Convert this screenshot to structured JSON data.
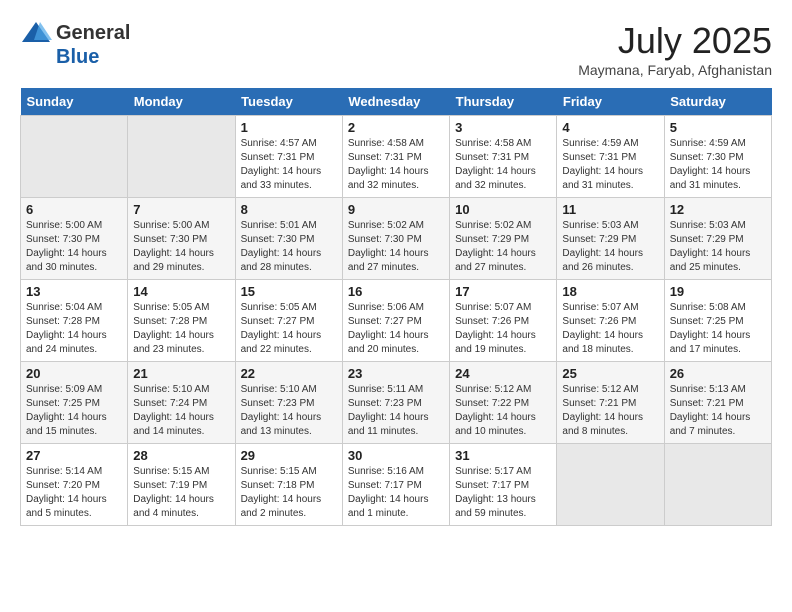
{
  "logo": {
    "general": "General",
    "blue": "Blue"
  },
  "header": {
    "month_year": "July 2025",
    "location": "Maymana, Faryab, Afghanistan"
  },
  "weekdays": [
    "Sunday",
    "Monday",
    "Tuesday",
    "Wednesday",
    "Thursday",
    "Friday",
    "Saturday"
  ],
  "weeks": [
    [
      {
        "day": "",
        "sunrise": "",
        "sunset": "",
        "daylight": ""
      },
      {
        "day": "",
        "sunrise": "",
        "sunset": "",
        "daylight": ""
      },
      {
        "day": "1",
        "sunrise": "Sunrise: 4:57 AM",
        "sunset": "Sunset: 7:31 PM",
        "daylight": "Daylight: 14 hours and 33 minutes."
      },
      {
        "day": "2",
        "sunrise": "Sunrise: 4:58 AM",
        "sunset": "Sunset: 7:31 PM",
        "daylight": "Daylight: 14 hours and 32 minutes."
      },
      {
        "day": "3",
        "sunrise": "Sunrise: 4:58 AM",
        "sunset": "Sunset: 7:31 PM",
        "daylight": "Daylight: 14 hours and 32 minutes."
      },
      {
        "day": "4",
        "sunrise": "Sunrise: 4:59 AM",
        "sunset": "Sunset: 7:31 PM",
        "daylight": "Daylight: 14 hours and 31 minutes."
      },
      {
        "day": "5",
        "sunrise": "Sunrise: 4:59 AM",
        "sunset": "Sunset: 7:30 PM",
        "daylight": "Daylight: 14 hours and 31 minutes."
      }
    ],
    [
      {
        "day": "6",
        "sunrise": "Sunrise: 5:00 AM",
        "sunset": "Sunset: 7:30 PM",
        "daylight": "Daylight: 14 hours and 30 minutes."
      },
      {
        "day": "7",
        "sunrise": "Sunrise: 5:00 AM",
        "sunset": "Sunset: 7:30 PM",
        "daylight": "Daylight: 14 hours and 29 minutes."
      },
      {
        "day": "8",
        "sunrise": "Sunrise: 5:01 AM",
        "sunset": "Sunset: 7:30 PM",
        "daylight": "Daylight: 14 hours and 28 minutes."
      },
      {
        "day": "9",
        "sunrise": "Sunrise: 5:02 AM",
        "sunset": "Sunset: 7:30 PM",
        "daylight": "Daylight: 14 hours and 27 minutes."
      },
      {
        "day": "10",
        "sunrise": "Sunrise: 5:02 AM",
        "sunset": "Sunset: 7:29 PM",
        "daylight": "Daylight: 14 hours and 27 minutes."
      },
      {
        "day": "11",
        "sunrise": "Sunrise: 5:03 AM",
        "sunset": "Sunset: 7:29 PM",
        "daylight": "Daylight: 14 hours and 26 minutes."
      },
      {
        "day": "12",
        "sunrise": "Sunrise: 5:03 AM",
        "sunset": "Sunset: 7:29 PM",
        "daylight": "Daylight: 14 hours and 25 minutes."
      }
    ],
    [
      {
        "day": "13",
        "sunrise": "Sunrise: 5:04 AM",
        "sunset": "Sunset: 7:28 PM",
        "daylight": "Daylight: 14 hours and 24 minutes."
      },
      {
        "day": "14",
        "sunrise": "Sunrise: 5:05 AM",
        "sunset": "Sunset: 7:28 PM",
        "daylight": "Daylight: 14 hours and 23 minutes."
      },
      {
        "day": "15",
        "sunrise": "Sunrise: 5:05 AM",
        "sunset": "Sunset: 7:27 PM",
        "daylight": "Daylight: 14 hours and 22 minutes."
      },
      {
        "day": "16",
        "sunrise": "Sunrise: 5:06 AM",
        "sunset": "Sunset: 7:27 PM",
        "daylight": "Daylight: 14 hours and 20 minutes."
      },
      {
        "day": "17",
        "sunrise": "Sunrise: 5:07 AM",
        "sunset": "Sunset: 7:26 PM",
        "daylight": "Daylight: 14 hours and 19 minutes."
      },
      {
        "day": "18",
        "sunrise": "Sunrise: 5:07 AM",
        "sunset": "Sunset: 7:26 PM",
        "daylight": "Daylight: 14 hours and 18 minutes."
      },
      {
        "day": "19",
        "sunrise": "Sunrise: 5:08 AM",
        "sunset": "Sunset: 7:25 PM",
        "daylight": "Daylight: 14 hours and 17 minutes."
      }
    ],
    [
      {
        "day": "20",
        "sunrise": "Sunrise: 5:09 AM",
        "sunset": "Sunset: 7:25 PM",
        "daylight": "Daylight: 14 hours and 15 minutes."
      },
      {
        "day": "21",
        "sunrise": "Sunrise: 5:10 AM",
        "sunset": "Sunset: 7:24 PM",
        "daylight": "Daylight: 14 hours and 14 minutes."
      },
      {
        "day": "22",
        "sunrise": "Sunrise: 5:10 AM",
        "sunset": "Sunset: 7:23 PM",
        "daylight": "Daylight: 14 hours and 13 minutes."
      },
      {
        "day": "23",
        "sunrise": "Sunrise: 5:11 AM",
        "sunset": "Sunset: 7:23 PM",
        "daylight": "Daylight: 14 hours and 11 minutes."
      },
      {
        "day": "24",
        "sunrise": "Sunrise: 5:12 AM",
        "sunset": "Sunset: 7:22 PM",
        "daylight": "Daylight: 14 hours and 10 minutes."
      },
      {
        "day": "25",
        "sunrise": "Sunrise: 5:12 AM",
        "sunset": "Sunset: 7:21 PM",
        "daylight": "Daylight: 14 hours and 8 minutes."
      },
      {
        "day": "26",
        "sunrise": "Sunrise: 5:13 AM",
        "sunset": "Sunset: 7:21 PM",
        "daylight": "Daylight: 14 hours and 7 minutes."
      }
    ],
    [
      {
        "day": "27",
        "sunrise": "Sunrise: 5:14 AM",
        "sunset": "Sunset: 7:20 PM",
        "daylight": "Daylight: 14 hours and 5 minutes."
      },
      {
        "day": "28",
        "sunrise": "Sunrise: 5:15 AM",
        "sunset": "Sunset: 7:19 PM",
        "daylight": "Daylight: 14 hours and 4 minutes."
      },
      {
        "day": "29",
        "sunrise": "Sunrise: 5:15 AM",
        "sunset": "Sunset: 7:18 PM",
        "daylight": "Daylight: 14 hours and 2 minutes."
      },
      {
        "day": "30",
        "sunrise": "Sunrise: 5:16 AM",
        "sunset": "Sunset: 7:17 PM",
        "daylight": "Daylight: 14 hours and 1 minute."
      },
      {
        "day": "31",
        "sunrise": "Sunrise: 5:17 AM",
        "sunset": "Sunset: 7:17 PM",
        "daylight": "Daylight: 13 hours and 59 minutes."
      },
      {
        "day": "",
        "sunrise": "",
        "sunset": "",
        "daylight": ""
      },
      {
        "day": "",
        "sunrise": "",
        "sunset": "",
        "daylight": ""
      }
    ]
  ]
}
